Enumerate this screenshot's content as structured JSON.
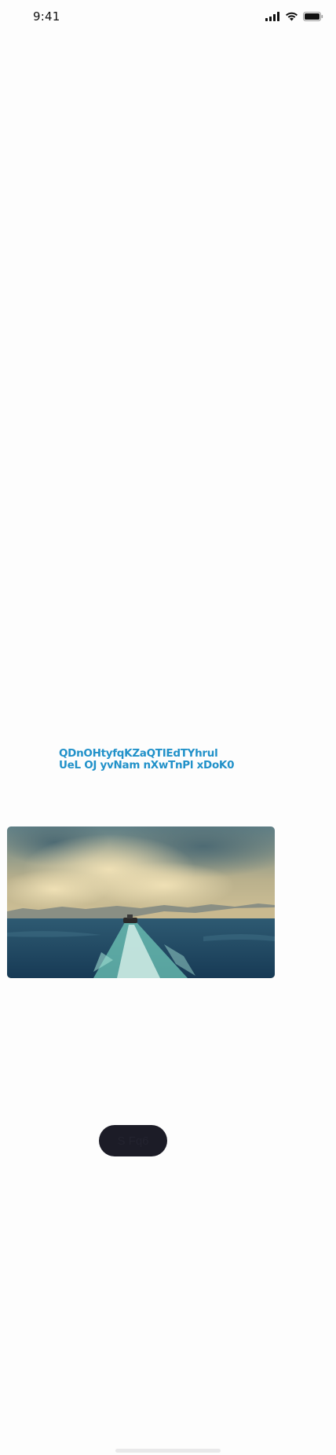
{
  "status_bar": {
    "time": "9:41",
    "icons": [
      "signal-icon",
      "wifi-icon",
      "battery-icon"
    ]
  },
  "headline": {
    "text": "QDnOHtyfqKZaQTIEdTYhrul\nUeL OJ yvNam nXwTnPl  xDoK0"
  },
  "hero_image": {
    "description_icon": "landscape-photo"
  },
  "cta": {
    "label": "S  Fq6"
  },
  "colors": {
    "accent": "#2191c9",
    "button_bg": "#1c1c27",
    "background": "#fdfdfd"
  }
}
